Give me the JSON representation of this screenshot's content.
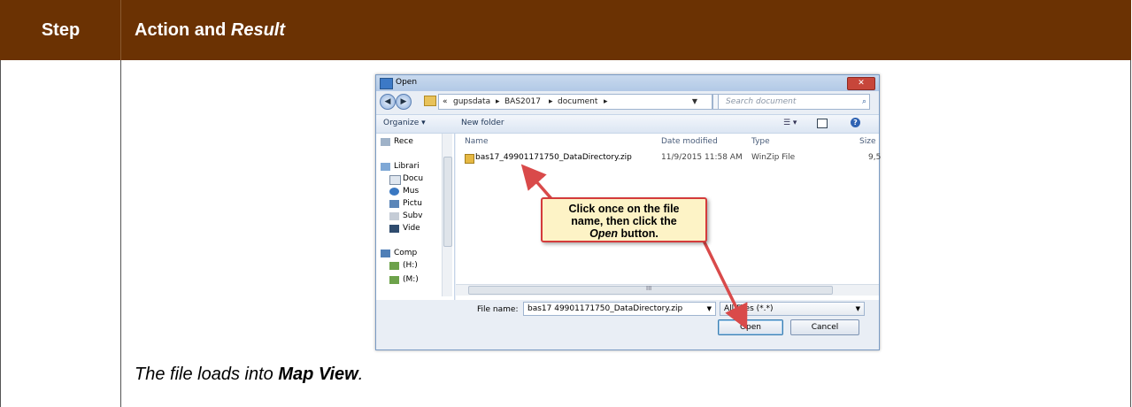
{
  "header": {
    "step": "Step",
    "action": "Action and ",
    "result": "Result"
  },
  "result_row": {
    "text_before": "The file loads into ",
    "bold": "Map View",
    "text_after": "."
  },
  "dialog": {
    "title": "Open",
    "close": "✕",
    "address": {
      "prefix": "«",
      "crumbs": [
        "gupsdata",
        "BAS2017",
        "document"
      ],
      "sep": "▸"
    },
    "search_placeholder": "Search document",
    "toolbar": {
      "organize": "Organize ▾",
      "new_folder": "New folder"
    },
    "nav_items": [
      {
        "label": "Rece",
        "icon": "recent-places-icon"
      },
      {
        "label": "Librari",
        "icon": "libraries-icon"
      },
      {
        "label": "Docu",
        "icon": "documents-icon"
      },
      {
        "label": "Mus",
        "icon": "music-icon"
      },
      {
        "label": "Pictu",
        "icon": "pictures-icon"
      },
      {
        "label": "Subv",
        "icon": "subversion-icon"
      },
      {
        "label": "Vide",
        "icon": "videos-icon"
      },
      {
        "label": "Comp",
        "icon": "computer-icon"
      },
      {
        "label": "(H:)",
        "icon": "network-drive-icon"
      },
      {
        "label": "(M:)",
        "icon": "network-drive-icon"
      }
    ],
    "columns": [
      "Name",
      "Date modified",
      "Type",
      "Size"
    ],
    "files": [
      {
        "name": "bas17_49901171750_DataDirectory.zip",
        "date": "11/9/2015 11:58 AM",
        "type": "WinZip File",
        "size": "9,5"
      }
    ],
    "scroll_glyph": "III",
    "file_name_label": "File name:",
    "file_name_value": "bas17 49901171750_DataDirectory.zip",
    "file_type": "All Files (*.*)",
    "open_button": "Open",
    "cancel_button": "Cancel"
  },
  "callout": {
    "line1": "Click once on the file",
    "line2": "name, then click the",
    "italic": "Open",
    "line3_rest": " button."
  },
  "colors": {
    "header_bg": "#6b3203",
    "callout_bg": "#fdf3c6",
    "callout_border": "#d43b3b",
    "arrow": "#d94a4a"
  }
}
